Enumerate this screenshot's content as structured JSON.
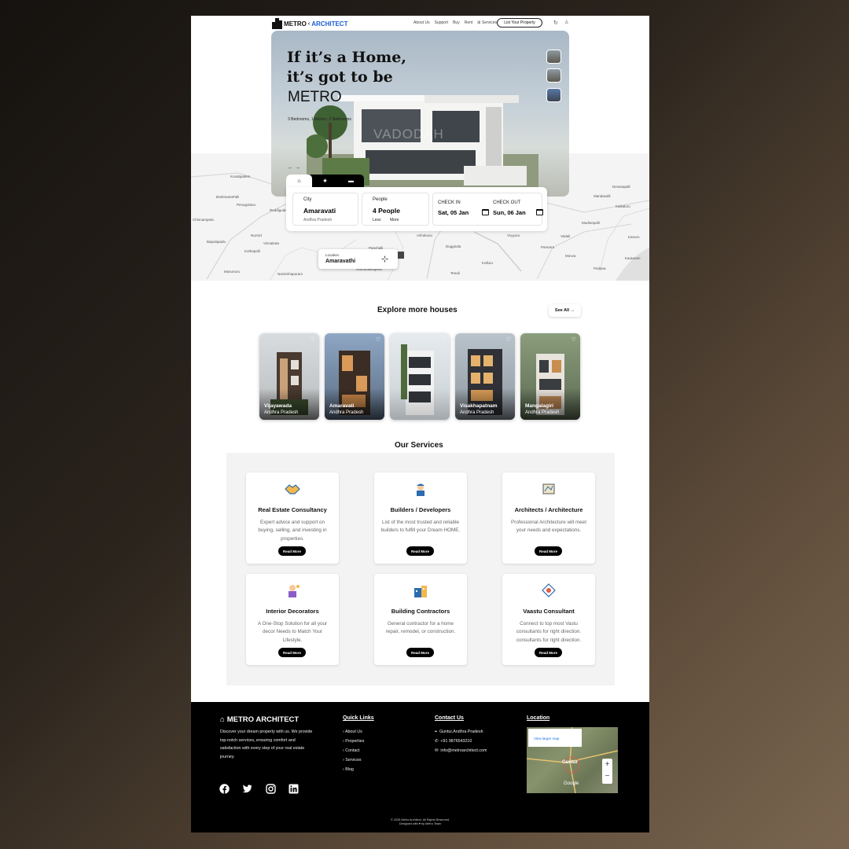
{
  "nav": {
    "brand_a": "METRO",
    "brand_b": "ARCHITECT",
    "links": [
      "About Us",
      "Support",
      "Buy",
      "Rent",
      "Services"
    ],
    "cta": "List Your Property"
  },
  "hero": {
    "headline": "If it’s a Home,\nit’s got to be",
    "brand": "METRO",
    "spec": "3 Bedrooms, 1 kitchen, 2 Bathrooms",
    "watermark": "VADODAH"
  },
  "search": {
    "city": {
      "label": "City",
      "value": "Amaravati",
      "sub": "Andhra Pradesh"
    },
    "people": {
      "label": "People",
      "value": "4 People",
      "less": "Less",
      "more": "More"
    },
    "checkin": {
      "label": "CHECK IN",
      "value": "Sat, 05 Jan"
    },
    "checkout": {
      "label": "CHECK OUT",
      "value": "Sun, 06 Jan"
    }
  },
  "location": {
    "label": "Location",
    "value": "Amaravathi"
  },
  "map_towns": [
    "Kondapalem",
    "BrahmanaPalli",
    "Penugolanu",
    "Reddigudem",
    "Chinnampeta",
    "Nuzvid",
    "Vinnakota",
    "Bapulapadu",
    "Kothapalli",
    "Musunuru",
    "Narsimhapuram",
    "Ramanakkapeta",
    "Ashokunu",
    "Duggirala",
    "Vuyyuru",
    "Pamarru",
    "Vadali",
    "Kautaram",
    "Mandavalli",
    "Kaikaluru",
    "Mudinepalli",
    "Movva",
    "Pedana",
    "Kanuru",
    "Tenali",
    "Kolluru",
    "Panchalli",
    "Devarapalli"
  ],
  "explore": {
    "title": "Explore more houses",
    "see_all": "See All →",
    "cards": [
      {
        "city": "Vijayawada",
        "state": "Andhra Pradesh"
      },
      {
        "city": "Amaravati",
        "state": "Andhra Pradesh"
      },
      {
        "city": "",
        "state": ""
      },
      {
        "city": "Visakhapatnam",
        "state": "Andhra Pradesh"
      },
      {
        "city": "Mangalagiri",
        "state": "Andhra Pradesh"
      }
    ]
  },
  "services": {
    "title": "Our Services",
    "read_more": "Read More",
    "items": [
      {
        "title": "Real Estate Consultancy",
        "desc": "Expert advice and support on buying, selling, and investing in properties.",
        "icon": "handshake-icon"
      },
      {
        "title": "Builders / Developers",
        "desc": "List of the most trusted and reliable builders to fulfill your Dream HOME.",
        "icon": "builder-icon"
      },
      {
        "title": "Architects / Architecture",
        "desc": "Professional Architecture will meet your needs and expectations.",
        "icon": "blueprint-icon"
      },
      {
        "title": "Interior Decorators",
        "desc": "A One-Stop Solution for all your decor Needs to Match Your Lifestyle.",
        "icon": "decorator-icon"
      },
      {
        "title": "Building Contractors",
        "desc": "General contractor for a home repair, remodel, or construction.",
        "icon": "contractor-icon"
      },
      {
        "title": "Vaastu Consultant",
        "desc": "Connect to top most Vastu consultants for right direction. consultants for right direction.",
        "icon": "vaastu-icon"
      }
    ]
  },
  "footer": {
    "brand": "METRO ARCHITECT",
    "desc": "Discover your dream property with us. We provide top-notch services, ensuring comfort and satisfaction with every step of your real estate journey.",
    "quick_title": "Quick Links",
    "quick_links": [
      "About Us",
      "Properties",
      "Contact",
      "Services",
      "Blog"
    ],
    "contact_title": "Contact Us",
    "address": "Guntur,Andhra Pradesh",
    "phone": "+91 9876543210",
    "email": "info@metroarchitect.com",
    "location_title": "Location",
    "map_place": "Guntur",
    "map_link": "View larger map",
    "map_city": "Guntur",
    "map_google": "Google",
    "copyright": "© 2025 Metro Architect. All Rights Reserved.",
    "designed": "Designed with ♥ by Metro Team"
  },
  "colors": {
    "accent": "#1a5fd0",
    "footer_bg": "#000000",
    "button_bg": "#000000"
  }
}
